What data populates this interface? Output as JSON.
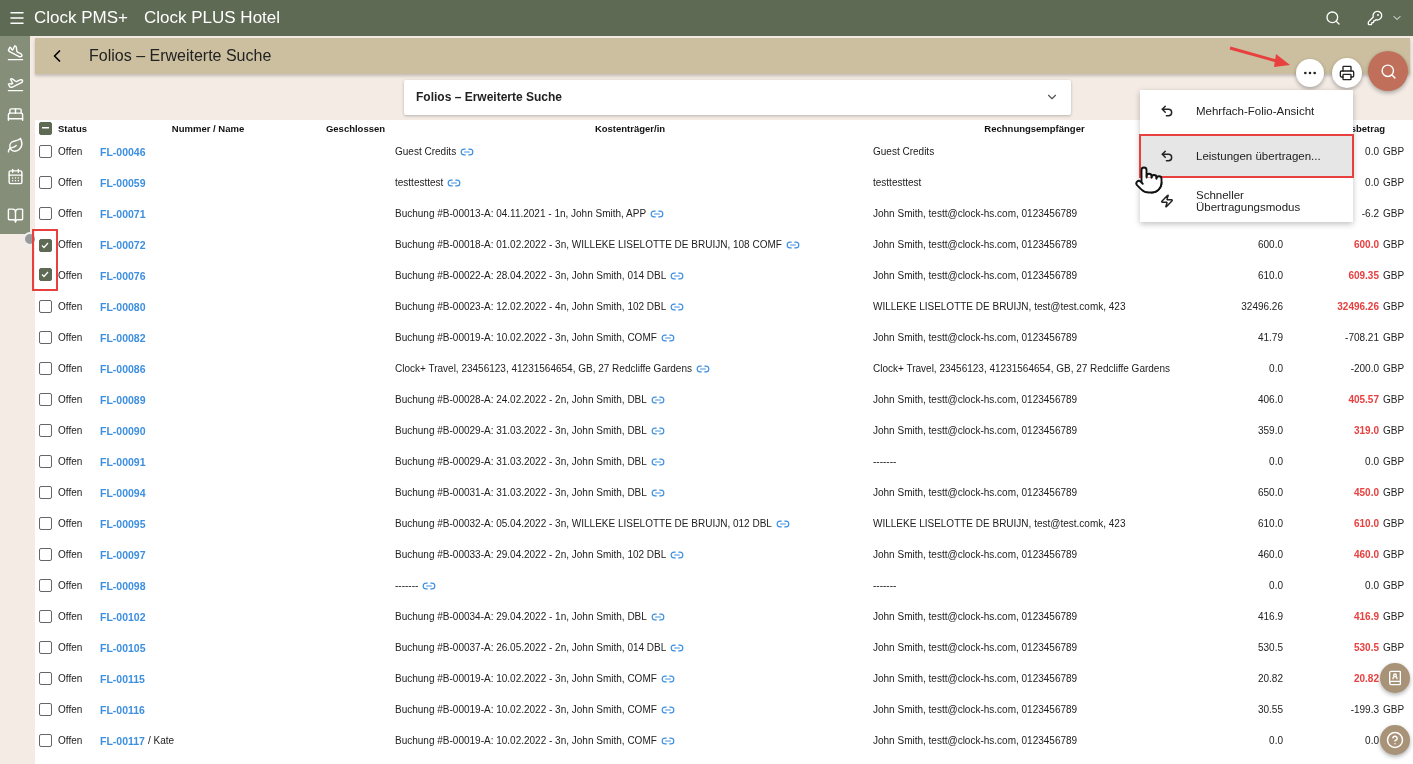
{
  "app_bar": {
    "app_name": "Clock PMS+",
    "hotel_name": "Clock PLUS Hotel"
  },
  "page_header": {
    "title": "Folios – Erweiterte Suche"
  },
  "filter_panel": {
    "title": "Folios – Erweiterte Suche",
    "expanded": false
  },
  "table": {
    "select_all_partial": true,
    "columns": [
      "Status",
      "Nummer / Name",
      "Geschlossen",
      "Kostenträger/in",
      "Rechnungsempfänger",
      "sbetrag"
    ],
    "rows": [
      {
        "checked": false,
        "marked": false,
        "status": "Offen",
        "number": "FL-00046",
        "payer": "Guest Credits",
        "recipient": "Guest Credits",
        "balance": "0.0",
        "currency": "GBP",
        "overdue": false
      },
      {
        "checked": false,
        "marked": false,
        "status": "Offen",
        "number": "FL-00059",
        "payer": "testtesttest",
        "recipient": "testtesttest",
        "balance": "0.0",
        "currency": "GBP",
        "overdue": false
      },
      {
        "checked": false,
        "marked": false,
        "status": "Offen",
        "number": "FL-00071",
        "payer": "Buchung #B-00013-A: 04.11.2021 - 1n, John Smith, APP",
        "recipient": "John Smith, testt@clock-hs.com, 0123456789",
        "balance": "-6.2",
        "currency": "GBP",
        "overdue": false
      },
      {
        "checked": true,
        "marked": true,
        "status": "Offen",
        "number": "FL-00072",
        "payer": "Buchung #B-00018-A: 01.02.2022 - 3n, WILLEKE LISELOTTE DE BRUIJN, 108 COMF",
        "recipient": "John Smith, testt@clock-hs.com, 0123456789",
        "amount": "600.0",
        "balance": "600.0",
        "currency": "GBP",
        "overdue": true
      },
      {
        "checked": true,
        "marked": true,
        "status": "Offen",
        "number": "FL-00076",
        "payer": "Buchung #B-00022-A: 28.04.2022 - 3n, John Smith, 014 DBL",
        "recipient": "John Smith, testt@clock-hs.com, 0123456789",
        "amount": "610.0",
        "balance": "609.35",
        "currency": "GBP",
        "overdue": true
      },
      {
        "checked": false,
        "marked": false,
        "status": "Offen",
        "number": "FL-00080",
        "payer": "Buchung #B-00023-A: 12.02.2022 - 4n, John Smith, 102 DBL",
        "recipient": "WILLEKE LISELOTTE DE BRUIJN, test@test.comk, 423",
        "amount": "32496.26",
        "balance": "32496.26",
        "currency": "GBP",
        "overdue": true
      },
      {
        "checked": false,
        "marked": false,
        "status": "Offen",
        "number": "FL-00082",
        "payer": "Buchung #B-00019-A: 10.02.2022 - 3n, John Smith, COMF",
        "recipient": "John Smith, testt@clock-hs.com, 0123456789",
        "amount": "41.79",
        "balance": "-708.21",
        "currency": "GBP",
        "overdue": false
      },
      {
        "checked": false,
        "marked": false,
        "status": "Offen",
        "number": "FL-00086",
        "payer": "Clock+ Travel, 23456123, 41231564654, GB, 27 Redcliffe Gardens",
        "recipient": "Clock+ Travel, 23456123, 41231564654, GB, 27 Redcliffe Gardens",
        "amount": "0.0",
        "balance": "-200.0",
        "currency": "GBP",
        "overdue": false
      },
      {
        "checked": false,
        "marked": false,
        "status": "Offen",
        "number": "FL-00089",
        "payer": "Buchung #B-00028-A: 24.02.2022 - 2n, John Smith, DBL",
        "recipient": "John Smith, testt@clock-hs.com, 0123456789",
        "amount": "406.0",
        "balance": "405.57",
        "currency": "GBP",
        "overdue": true
      },
      {
        "checked": false,
        "marked": false,
        "status": "Offen",
        "number": "FL-00090",
        "payer": "Buchung #B-00029-A: 31.03.2022 - 3n, John Smith, DBL",
        "recipient": "John Smith, testt@clock-hs.com, 0123456789",
        "amount": "359.0",
        "balance": "319.0",
        "currency": "GBP",
        "overdue": true
      },
      {
        "checked": false,
        "marked": false,
        "status": "Offen",
        "number": "FL-00091",
        "payer": "Buchung #B-00029-A: 31.03.2022 - 3n, John Smith, DBL",
        "recipient": "-------",
        "amount": "0.0",
        "balance": "0.0",
        "currency": "GBP",
        "overdue": false
      },
      {
        "checked": false,
        "marked": false,
        "status": "Offen",
        "number": "FL-00094",
        "payer": "Buchung #B-00031-A: 31.03.2022 - 3n, John Smith, DBL",
        "recipient": "John Smith, testt@clock-hs.com, 0123456789",
        "amount": "650.0",
        "balance": "450.0",
        "currency": "GBP",
        "overdue": true
      },
      {
        "checked": false,
        "marked": false,
        "status": "Offen",
        "number": "FL-00095",
        "payer": "Buchung #B-00032-A: 05.04.2022 - 3n, WILLEKE LISELOTTE DE BRUIJN, 012 DBL",
        "recipient": "WILLEKE LISELOTTE DE BRUIJN, test@test.comk, 423",
        "amount": "610.0",
        "balance": "610.0",
        "currency": "GBP",
        "overdue": true
      },
      {
        "checked": false,
        "marked": false,
        "status": "Offen",
        "number": "FL-00097",
        "payer": "Buchung #B-00033-A: 29.04.2022 - 2n, John Smith, 102 DBL",
        "recipient": "John Smith, testt@clock-hs.com, 0123456789",
        "amount": "460.0",
        "balance": "460.0",
        "currency": "GBP",
        "overdue": true
      },
      {
        "checked": false,
        "marked": false,
        "status": "Offen",
        "number": "FL-00098",
        "payer": "-------",
        "recipient": "-------",
        "amount": "0.0",
        "balance": "0.0",
        "currency": "GBP",
        "overdue": false
      },
      {
        "checked": false,
        "marked": false,
        "status": "Offen",
        "number": "FL-00102",
        "payer": "Buchung #B-00034-A: 29.04.2022 - 1n, John Smith, DBL",
        "recipient": "John Smith, testt@clock-hs.com, 0123456789",
        "amount": "416.9",
        "balance": "416.9",
        "currency": "GBP",
        "overdue": true
      },
      {
        "checked": false,
        "marked": false,
        "status": "Offen",
        "number": "FL-00105",
        "payer": "Buchung #B-00037-A: 26.05.2022 - 2n, John Smith, 014 DBL",
        "recipient": "John Smith, testt@clock-hs.com, 0123456789",
        "amount": "530.5",
        "balance": "530.5",
        "currency": "GBP",
        "overdue": true
      },
      {
        "checked": false,
        "marked": false,
        "status": "Offen",
        "number": "FL-00115",
        "payer": "Buchung #B-00019-A: 10.02.2022 - 3n, John Smith, COMF",
        "recipient": "John Smith, testt@clock-hs.com, 0123456789",
        "amount": "20.82",
        "balance": "20.82",
        "overdue": true
      },
      {
        "checked": false,
        "marked": false,
        "status": "Offen",
        "number": "FL-00116",
        "payer": "Buchung #B-00019-A: 10.02.2022 - 3n, John Smith, COMF",
        "recipient": "John Smith, testt@clock-hs.com, 0123456789",
        "amount": "30.55",
        "balance": "-199.3",
        "currency": "GBP",
        "overdue": false
      },
      {
        "checked": false,
        "marked": false,
        "status": "Offen",
        "number": "FL-00117",
        "name": "/ Kate",
        "payer": "Buchung #B-00019-A: 10.02.2022 - 3n, John Smith, COMF",
        "recipient": "John Smith, testt@clock-hs.com, 0123456789",
        "amount": "0.0",
        "balance": "0.0",
        "overdue": false
      }
    ]
  },
  "actions_menu": {
    "items": [
      {
        "kind": "undo",
        "label": "Mehrfach-Folio-Ansicht",
        "highlighted": false,
        "marked": false
      },
      {
        "kind": "undo",
        "label": "Leistungen übertragen...",
        "highlighted": true,
        "marked": true
      },
      {
        "kind": "flash",
        "label": "Schneller Übertragungsmodus",
        "highlighted": false,
        "marked": false
      }
    ]
  }
}
